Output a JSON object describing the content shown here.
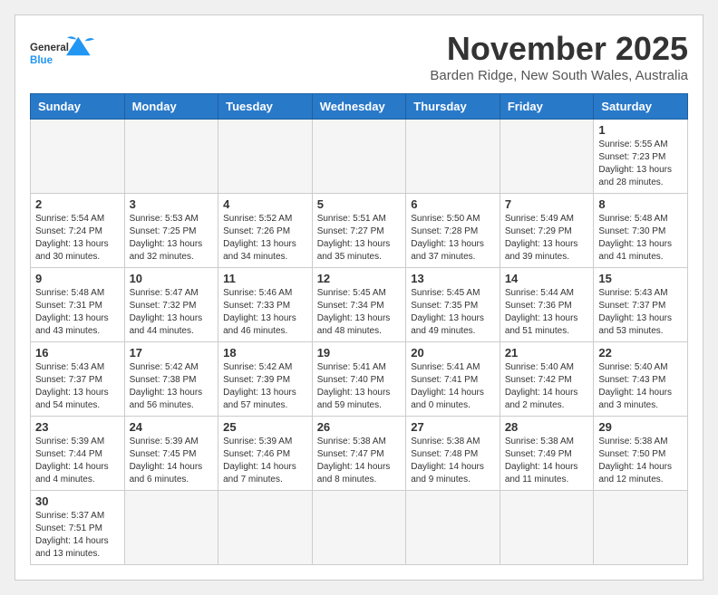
{
  "header": {
    "month": "November 2025",
    "location": "Barden Ridge, New South Wales, Australia"
  },
  "days_of_week": [
    "Sunday",
    "Monday",
    "Tuesday",
    "Wednesday",
    "Thursday",
    "Friday",
    "Saturday"
  ],
  "weeks": [
    [
      {
        "day": "",
        "info": ""
      },
      {
        "day": "",
        "info": ""
      },
      {
        "day": "",
        "info": ""
      },
      {
        "day": "",
        "info": ""
      },
      {
        "day": "",
        "info": ""
      },
      {
        "day": "",
        "info": ""
      },
      {
        "day": "1",
        "info": "Sunrise: 5:55 AM\nSunset: 7:23 PM\nDaylight: 13 hours\nand 28 minutes."
      }
    ],
    [
      {
        "day": "2",
        "info": "Sunrise: 5:54 AM\nSunset: 7:24 PM\nDaylight: 13 hours\nand 30 minutes."
      },
      {
        "day": "3",
        "info": "Sunrise: 5:53 AM\nSunset: 7:25 PM\nDaylight: 13 hours\nand 32 minutes."
      },
      {
        "day": "4",
        "info": "Sunrise: 5:52 AM\nSunset: 7:26 PM\nDaylight: 13 hours\nand 34 minutes."
      },
      {
        "day": "5",
        "info": "Sunrise: 5:51 AM\nSunset: 7:27 PM\nDaylight: 13 hours\nand 35 minutes."
      },
      {
        "day": "6",
        "info": "Sunrise: 5:50 AM\nSunset: 7:28 PM\nDaylight: 13 hours\nand 37 minutes."
      },
      {
        "day": "7",
        "info": "Sunrise: 5:49 AM\nSunset: 7:29 PM\nDaylight: 13 hours\nand 39 minutes."
      },
      {
        "day": "8",
        "info": "Sunrise: 5:48 AM\nSunset: 7:30 PM\nDaylight: 13 hours\nand 41 minutes."
      }
    ],
    [
      {
        "day": "9",
        "info": "Sunrise: 5:48 AM\nSunset: 7:31 PM\nDaylight: 13 hours\nand 43 minutes."
      },
      {
        "day": "10",
        "info": "Sunrise: 5:47 AM\nSunset: 7:32 PM\nDaylight: 13 hours\nand 44 minutes."
      },
      {
        "day": "11",
        "info": "Sunrise: 5:46 AM\nSunset: 7:33 PM\nDaylight: 13 hours\nand 46 minutes."
      },
      {
        "day": "12",
        "info": "Sunrise: 5:45 AM\nSunset: 7:34 PM\nDaylight: 13 hours\nand 48 minutes."
      },
      {
        "day": "13",
        "info": "Sunrise: 5:45 AM\nSunset: 7:35 PM\nDaylight: 13 hours\nand 49 minutes."
      },
      {
        "day": "14",
        "info": "Sunrise: 5:44 AM\nSunset: 7:36 PM\nDaylight: 13 hours\nand 51 minutes."
      },
      {
        "day": "15",
        "info": "Sunrise: 5:43 AM\nSunset: 7:37 PM\nDaylight: 13 hours\nand 53 minutes."
      }
    ],
    [
      {
        "day": "16",
        "info": "Sunrise: 5:43 AM\nSunset: 7:37 PM\nDaylight: 13 hours\nand 54 minutes."
      },
      {
        "day": "17",
        "info": "Sunrise: 5:42 AM\nSunset: 7:38 PM\nDaylight: 13 hours\nand 56 minutes."
      },
      {
        "day": "18",
        "info": "Sunrise: 5:42 AM\nSunset: 7:39 PM\nDaylight: 13 hours\nand 57 minutes."
      },
      {
        "day": "19",
        "info": "Sunrise: 5:41 AM\nSunset: 7:40 PM\nDaylight: 13 hours\nand 59 minutes."
      },
      {
        "day": "20",
        "info": "Sunrise: 5:41 AM\nSunset: 7:41 PM\nDaylight: 14 hours\nand 0 minutes."
      },
      {
        "day": "21",
        "info": "Sunrise: 5:40 AM\nSunset: 7:42 PM\nDaylight: 14 hours\nand 2 minutes."
      },
      {
        "day": "22",
        "info": "Sunrise: 5:40 AM\nSunset: 7:43 PM\nDaylight: 14 hours\nand 3 minutes."
      }
    ],
    [
      {
        "day": "23",
        "info": "Sunrise: 5:39 AM\nSunset: 7:44 PM\nDaylight: 14 hours\nand 4 minutes."
      },
      {
        "day": "24",
        "info": "Sunrise: 5:39 AM\nSunset: 7:45 PM\nDaylight: 14 hours\nand 6 minutes."
      },
      {
        "day": "25",
        "info": "Sunrise: 5:39 AM\nSunset: 7:46 PM\nDaylight: 14 hours\nand 7 minutes."
      },
      {
        "day": "26",
        "info": "Sunrise: 5:38 AM\nSunset: 7:47 PM\nDaylight: 14 hours\nand 8 minutes."
      },
      {
        "day": "27",
        "info": "Sunrise: 5:38 AM\nSunset: 7:48 PM\nDaylight: 14 hours\nand 9 minutes."
      },
      {
        "day": "28",
        "info": "Sunrise: 5:38 AM\nSunset: 7:49 PM\nDaylight: 14 hours\nand 11 minutes."
      },
      {
        "day": "29",
        "info": "Sunrise: 5:38 AM\nSunset: 7:50 PM\nDaylight: 14 hours\nand 12 minutes."
      }
    ],
    [
      {
        "day": "30",
        "info": "Sunrise: 5:37 AM\nSunset: 7:51 PM\nDaylight: 14 hours\nand 13 minutes."
      },
      {
        "day": "",
        "info": ""
      },
      {
        "day": "",
        "info": ""
      },
      {
        "day": "",
        "info": ""
      },
      {
        "day": "",
        "info": ""
      },
      {
        "day": "",
        "info": ""
      },
      {
        "day": "",
        "info": ""
      }
    ]
  ]
}
